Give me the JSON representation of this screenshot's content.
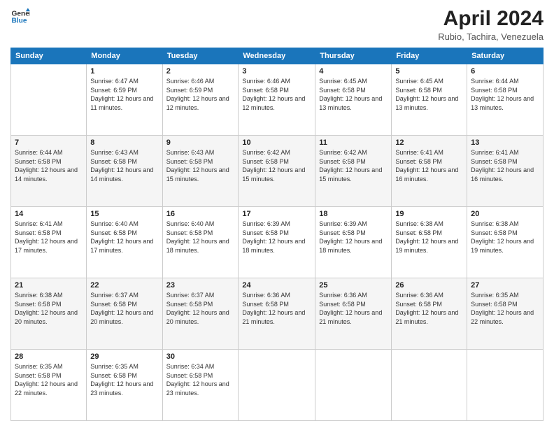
{
  "header": {
    "logo_line1": "General",
    "logo_line2": "Blue",
    "title": "April 2024",
    "subtitle": "Rubio, Tachira, Venezuela"
  },
  "calendar": {
    "days_of_week": [
      "Sunday",
      "Monday",
      "Tuesday",
      "Wednesday",
      "Thursday",
      "Friday",
      "Saturday"
    ],
    "weeks": [
      [
        {
          "day": "",
          "sunrise": "",
          "sunset": "",
          "daylight": ""
        },
        {
          "day": "1",
          "sunrise": "Sunrise: 6:47 AM",
          "sunset": "Sunset: 6:59 PM",
          "daylight": "Daylight: 12 hours and 11 minutes."
        },
        {
          "day": "2",
          "sunrise": "Sunrise: 6:46 AM",
          "sunset": "Sunset: 6:59 PM",
          "daylight": "Daylight: 12 hours and 12 minutes."
        },
        {
          "day": "3",
          "sunrise": "Sunrise: 6:46 AM",
          "sunset": "Sunset: 6:58 PM",
          "daylight": "Daylight: 12 hours and 12 minutes."
        },
        {
          "day": "4",
          "sunrise": "Sunrise: 6:45 AM",
          "sunset": "Sunset: 6:58 PM",
          "daylight": "Daylight: 12 hours and 13 minutes."
        },
        {
          "day": "5",
          "sunrise": "Sunrise: 6:45 AM",
          "sunset": "Sunset: 6:58 PM",
          "daylight": "Daylight: 12 hours and 13 minutes."
        },
        {
          "day": "6",
          "sunrise": "Sunrise: 6:44 AM",
          "sunset": "Sunset: 6:58 PM",
          "daylight": "Daylight: 12 hours and 13 minutes."
        }
      ],
      [
        {
          "day": "7",
          "sunrise": "Sunrise: 6:44 AM",
          "sunset": "Sunset: 6:58 PM",
          "daylight": "Daylight: 12 hours and 14 minutes."
        },
        {
          "day": "8",
          "sunrise": "Sunrise: 6:43 AM",
          "sunset": "Sunset: 6:58 PM",
          "daylight": "Daylight: 12 hours and 14 minutes."
        },
        {
          "day": "9",
          "sunrise": "Sunrise: 6:43 AM",
          "sunset": "Sunset: 6:58 PM",
          "daylight": "Daylight: 12 hours and 15 minutes."
        },
        {
          "day": "10",
          "sunrise": "Sunrise: 6:42 AM",
          "sunset": "Sunset: 6:58 PM",
          "daylight": "Daylight: 12 hours and 15 minutes."
        },
        {
          "day": "11",
          "sunrise": "Sunrise: 6:42 AM",
          "sunset": "Sunset: 6:58 PM",
          "daylight": "Daylight: 12 hours and 15 minutes."
        },
        {
          "day": "12",
          "sunrise": "Sunrise: 6:41 AM",
          "sunset": "Sunset: 6:58 PM",
          "daylight": "Daylight: 12 hours and 16 minutes."
        },
        {
          "day": "13",
          "sunrise": "Sunrise: 6:41 AM",
          "sunset": "Sunset: 6:58 PM",
          "daylight": "Daylight: 12 hours and 16 minutes."
        }
      ],
      [
        {
          "day": "14",
          "sunrise": "Sunrise: 6:41 AM",
          "sunset": "Sunset: 6:58 PM",
          "daylight": "Daylight: 12 hours and 17 minutes."
        },
        {
          "day": "15",
          "sunrise": "Sunrise: 6:40 AM",
          "sunset": "Sunset: 6:58 PM",
          "daylight": "Daylight: 12 hours and 17 minutes."
        },
        {
          "day": "16",
          "sunrise": "Sunrise: 6:40 AM",
          "sunset": "Sunset: 6:58 PM",
          "daylight": "Daylight: 12 hours and 18 minutes."
        },
        {
          "day": "17",
          "sunrise": "Sunrise: 6:39 AM",
          "sunset": "Sunset: 6:58 PM",
          "daylight": "Daylight: 12 hours and 18 minutes."
        },
        {
          "day": "18",
          "sunrise": "Sunrise: 6:39 AM",
          "sunset": "Sunset: 6:58 PM",
          "daylight": "Daylight: 12 hours and 18 minutes."
        },
        {
          "day": "19",
          "sunrise": "Sunrise: 6:38 AM",
          "sunset": "Sunset: 6:58 PM",
          "daylight": "Daylight: 12 hours and 19 minutes."
        },
        {
          "day": "20",
          "sunrise": "Sunrise: 6:38 AM",
          "sunset": "Sunset: 6:58 PM",
          "daylight": "Daylight: 12 hours and 19 minutes."
        }
      ],
      [
        {
          "day": "21",
          "sunrise": "Sunrise: 6:38 AM",
          "sunset": "Sunset: 6:58 PM",
          "daylight": "Daylight: 12 hours and 20 minutes."
        },
        {
          "day": "22",
          "sunrise": "Sunrise: 6:37 AM",
          "sunset": "Sunset: 6:58 PM",
          "daylight": "Daylight: 12 hours and 20 minutes."
        },
        {
          "day": "23",
          "sunrise": "Sunrise: 6:37 AM",
          "sunset": "Sunset: 6:58 PM",
          "daylight": "Daylight: 12 hours and 20 minutes."
        },
        {
          "day": "24",
          "sunrise": "Sunrise: 6:36 AM",
          "sunset": "Sunset: 6:58 PM",
          "daylight": "Daylight: 12 hours and 21 minutes."
        },
        {
          "day": "25",
          "sunrise": "Sunrise: 6:36 AM",
          "sunset": "Sunset: 6:58 PM",
          "daylight": "Daylight: 12 hours and 21 minutes."
        },
        {
          "day": "26",
          "sunrise": "Sunrise: 6:36 AM",
          "sunset": "Sunset: 6:58 PM",
          "daylight": "Daylight: 12 hours and 21 minutes."
        },
        {
          "day": "27",
          "sunrise": "Sunrise: 6:35 AM",
          "sunset": "Sunset: 6:58 PM",
          "daylight": "Daylight: 12 hours and 22 minutes."
        }
      ],
      [
        {
          "day": "28",
          "sunrise": "Sunrise: 6:35 AM",
          "sunset": "Sunset: 6:58 PM",
          "daylight": "Daylight: 12 hours and 22 minutes."
        },
        {
          "day": "29",
          "sunrise": "Sunrise: 6:35 AM",
          "sunset": "Sunset: 6:58 PM",
          "daylight": "Daylight: 12 hours and 23 minutes."
        },
        {
          "day": "30",
          "sunrise": "Sunrise: 6:34 AM",
          "sunset": "Sunset: 6:58 PM",
          "daylight": "Daylight: 12 hours and 23 minutes."
        },
        {
          "day": "",
          "sunrise": "",
          "sunset": "",
          "daylight": ""
        },
        {
          "day": "",
          "sunrise": "",
          "sunset": "",
          "daylight": ""
        },
        {
          "day": "",
          "sunrise": "",
          "sunset": "",
          "daylight": ""
        },
        {
          "day": "",
          "sunrise": "",
          "sunset": "",
          "daylight": ""
        }
      ]
    ]
  }
}
